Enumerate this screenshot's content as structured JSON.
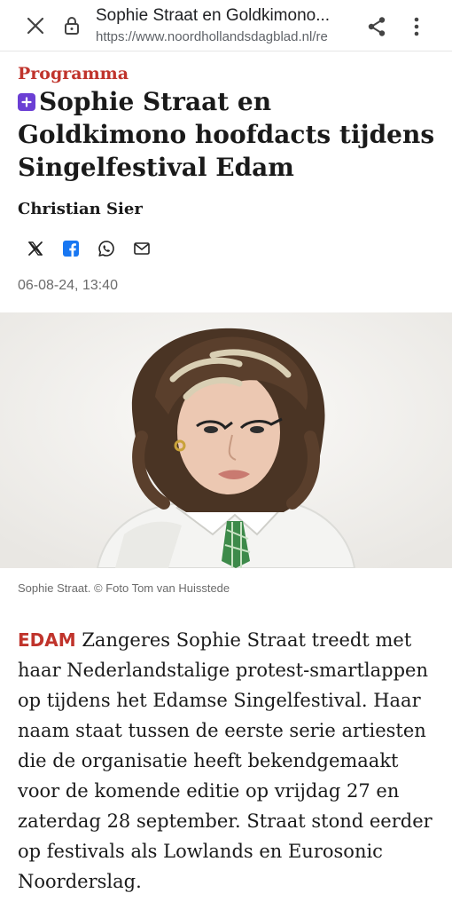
{
  "browser": {
    "page_title": "Sophie Straat en Goldkimono...",
    "url": "https://www.noordhollandsdagblad.nl/re",
    "icons": [
      "close-icon",
      "lock-icon",
      "share-icon",
      "more-vert-icon"
    ]
  },
  "article": {
    "section": "Programma",
    "headline": "Sophie Straat en Goldkimono hoofdacts tijdens Singelfestival Edam",
    "author": "Christian Sier",
    "share_icons": [
      "x-icon",
      "facebook-icon",
      "whatsapp-icon",
      "mail-icon"
    ],
    "date": "06-08-24, 13:40",
    "photo_caption": "Sophie Straat.  © Foto Tom van Huisstede",
    "dateline": "EDAM",
    "body": " Zangeres Sophie Straat treedt met haar Nederlandstalige protest-smartlappen op tijdens het Edamse Singelfestival. Haar naam staat tussen de eerste serie artiesten die de organisatie heeft bekendgemaakt voor de komende editie op vrijdag 27 en zaterdag 28 september. Straat stond eerder op festivals als Lowlands en Eurosonic Noorderslag."
  },
  "colors": {
    "accent": "#c0342c",
    "plus_badge": "#6b3fd4",
    "facebook": "#1877f2"
  }
}
